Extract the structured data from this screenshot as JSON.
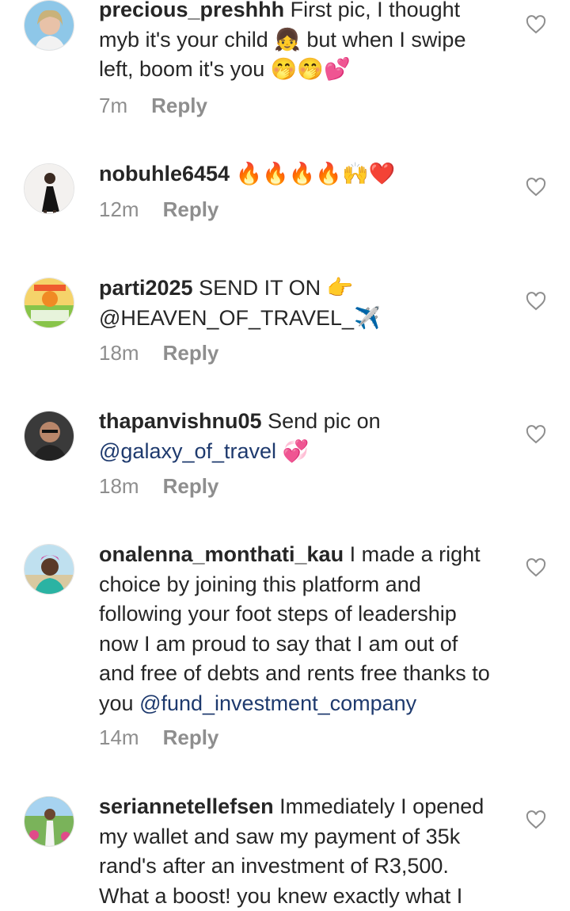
{
  "comments": [
    {
      "username": "precious_preshhh",
      "text": "First pic, I thought myb it's your child 👧 but when I swipe left, boom it's you 🤭🤭💕",
      "mention": "",
      "time": "7m",
      "reply_label": "Reply"
    },
    {
      "username": "nobuhle6454",
      "text": "🔥🔥🔥🔥🙌❤️",
      "mention": "",
      "time": "12m",
      "reply_label": "Reply"
    },
    {
      "username": "parti2025",
      "text": "SEND IT ON 👉@HEAVEN_OF_TRAVEL_✈️",
      "mention": "",
      "time": "18m",
      "reply_label": "Reply"
    },
    {
      "username": "thapanvishnu05",
      "text": "Send pic on",
      "mention": "@galaxy_of_travel",
      "after_mention": "💞",
      "time": "18m",
      "reply_label": "Reply"
    },
    {
      "username": "onalenna_monthati_kau",
      "text": "I made a right choice by joining this platform and following your foot steps of leadership now I am proud to say that I am out of and free of debts and rents free thanks to you",
      "mention": "@fund_investment_company",
      "time": "14m",
      "reply_label": "Reply"
    },
    {
      "username": "seriannetellefsen",
      "text": "Immediately I opened my wallet and saw my payment of 35k rand's after an investment of R3,500. What a boost! you knew exactly what I",
      "mention": "",
      "time": "",
      "reply_label": ""
    }
  ],
  "colors": {
    "mention": "#1e3a6e",
    "meta": "#8e8e8e",
    "text": "#262626"
  },
  "icons": {
    "like": "heart-outline-icon"
  }
}
